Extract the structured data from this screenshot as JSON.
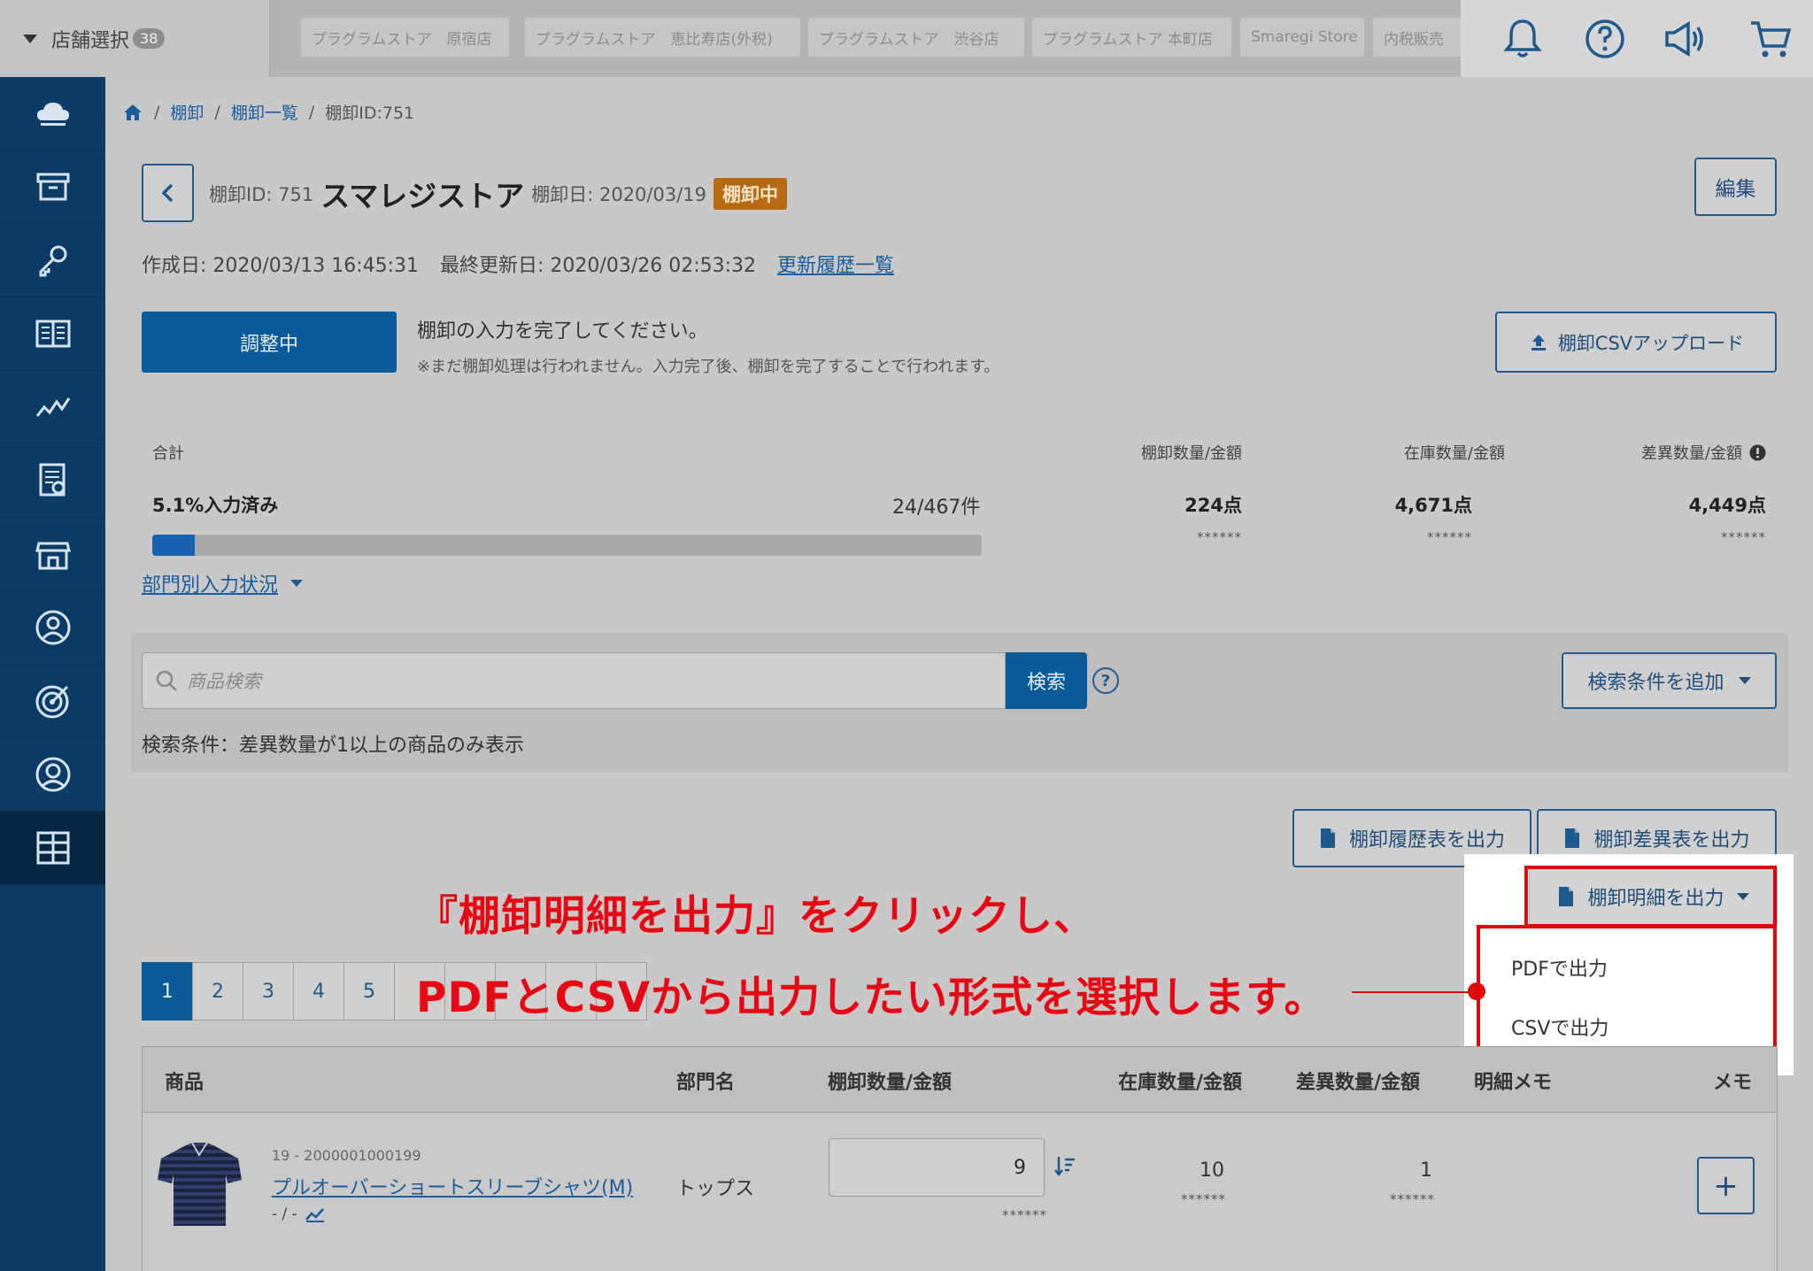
{
  "header": {
    "store_select_label": "店舗選択",
    "store_count": "38",
    "store_tabs": [
      "プラグラムストア　原宿店",
      "プラグラムストア　恵比寿店(外税)",
      "プラグラムストア　渋谷店",
      "プラグラムストア 本町店",
      "Smaregi Store",
      "内税販売"
    ],
    "icons": [
      "bell-icon",
      "help-icon",
      "megaphone-icon",
      "cart-icon"
    ]
  },
  "sidebar": {
    "items": [
      "cloud-icon",
      "archive-icon",
      "key-icon",
      "book-icon",
      "chart-icon",
      "report-icon",
      "store-icon",
      "user-icon",
      "target-icon",
      "customer-icon",
      "grid-icon"
    ],
    "active_index": 10
  },
  "breadcrumb": [
    "棚卸",
    "棚卸一覧",
    "棚卸ID:751"
  ],
  "title": {
    "id_label": "棚卸ID: 751",
    "store_name": "スマレジストア",
    "date_label": "棚卸日: 2020/03/19",
    "status": "棚卸中",
    "edit_label": "編集"
  },
  "meta": {
    "created": "作成日: 2020/03/13 16:45:31",
    "updated": "最終更新日: 2020/03/26 02:53:32",
    "history_link": "更新履歴一覧"
  },
  "status_panel": {
    "adjust_label": "調整中",
    "notice_main": "棚卸の入力を完了してください。",
    "notice_sub": "※まだ棚卸処理は行われません。入力完了後、棚卸を完了することで行われます。",
    "csv_upload_label": "棚卸CSVアップロード"
  },
  "summary": {
    "total_label": "合計",
    "progress_label": "5.1%入力済み",
    "progress_fraction": 0.051,
    "count": "24/467件",
    "columns": [
      {
        "label": "棚卸数量/金額",
        "value": "224点",
        "amount": "******"
      },
      {
        "label": "在庫数量/金額",
        "value": "4,671点",
        "amount": "******"
      },
      {
        "label": "差異数量/金額",
        "value": "4,449点",
        "amount": "******"
      }
    ],
    "dept_link": "部門別入力状況"
  },
  "search": {
    "placeholder": "商品検索",
    "button": "検索",
    "help": "?",
    "add_condition": "検索条件を追加",
    "condition_text": "検索条件：差異数量が1以上の商品のみ表示"
  },
  "output": {
    "history": "棚卸履歴表を出力",
    "diff": "棚卸差異表を出力",
    "detail": "棚卸明細を出力",
    "menu": [
      "PDFで出力",
      "CSVで出力"
    ]
  },
  "annotation": {
    "line1": "『棚卸明細を出力』をクリックし、",
    "line2": "PDFとCSVから出力したい形式を選択します。"
  },
  "pagination": {
    "pages": [
      "1",
      "2",
      "3",
      "4",
      "5"
    ],
    "active": "1"
  },
  "table": {
    "headers": [
      "商品",
      "部門名",
      "棚卸数量/金額",
      "在庫数量/金額",
      "差異数量/金額",
      "明細メモ",
      "メモ"
    ],
    "rows": [
      {
        "code": "19 - 2000001000199",
        "name": "プルオーバーショートスリーブシャツ(M)",
        "variant": "- / -",
        "dept": "トップス",
        "count_qty": "9",
        "count_amount": "******",
        "stock_qty": "10",
        "stock_amount": "******",
        "diff_qty": "1",
        "diff_amount": "******",
        "plus": "+"
      }
    ]
  }
}
